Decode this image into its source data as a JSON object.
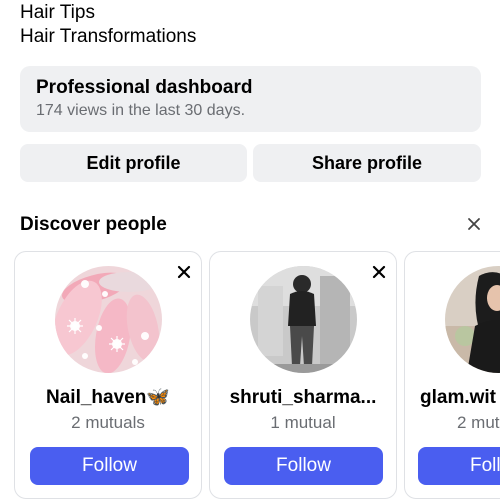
{
  "profile": {
    "bio_lines": [
      "Hair Tips",
      "Hair Transformations"
    ]
  },
  "dashboard": {
    "title": "Professional dashboard",
    "subtitle": "174 views in the last 30 days."
  },
  "actions": {
    "edit_label": "Edit profile",
    "share_label": "Share profile"
  },
  "discover": {
    "title": "Discover people",
    "close_icon": "close-icon",
    "cards": [
      {
        "username": "Nail_haven🦋",
        "mutuals": "2 mutuals",
        "follow_label": "Follow",
        "close_icon": "close-icon"
      },
      {
        "username": "shruti_sharma...",
        "mutuals": "1 mutual",
        "follow_label": "Follow",
        "close_icon": "close-icon"
      },
      {
        "username": "glam.wit",
        "mutuals": "2 mut",
        "follow_label": "Foll"
      }
    ]
  },
  "colors": {
    "follow_button": "#4a5ef0",
    "card_background": "#eff0f2",
    "secondary_text": "#6a6d72"
  }
}
